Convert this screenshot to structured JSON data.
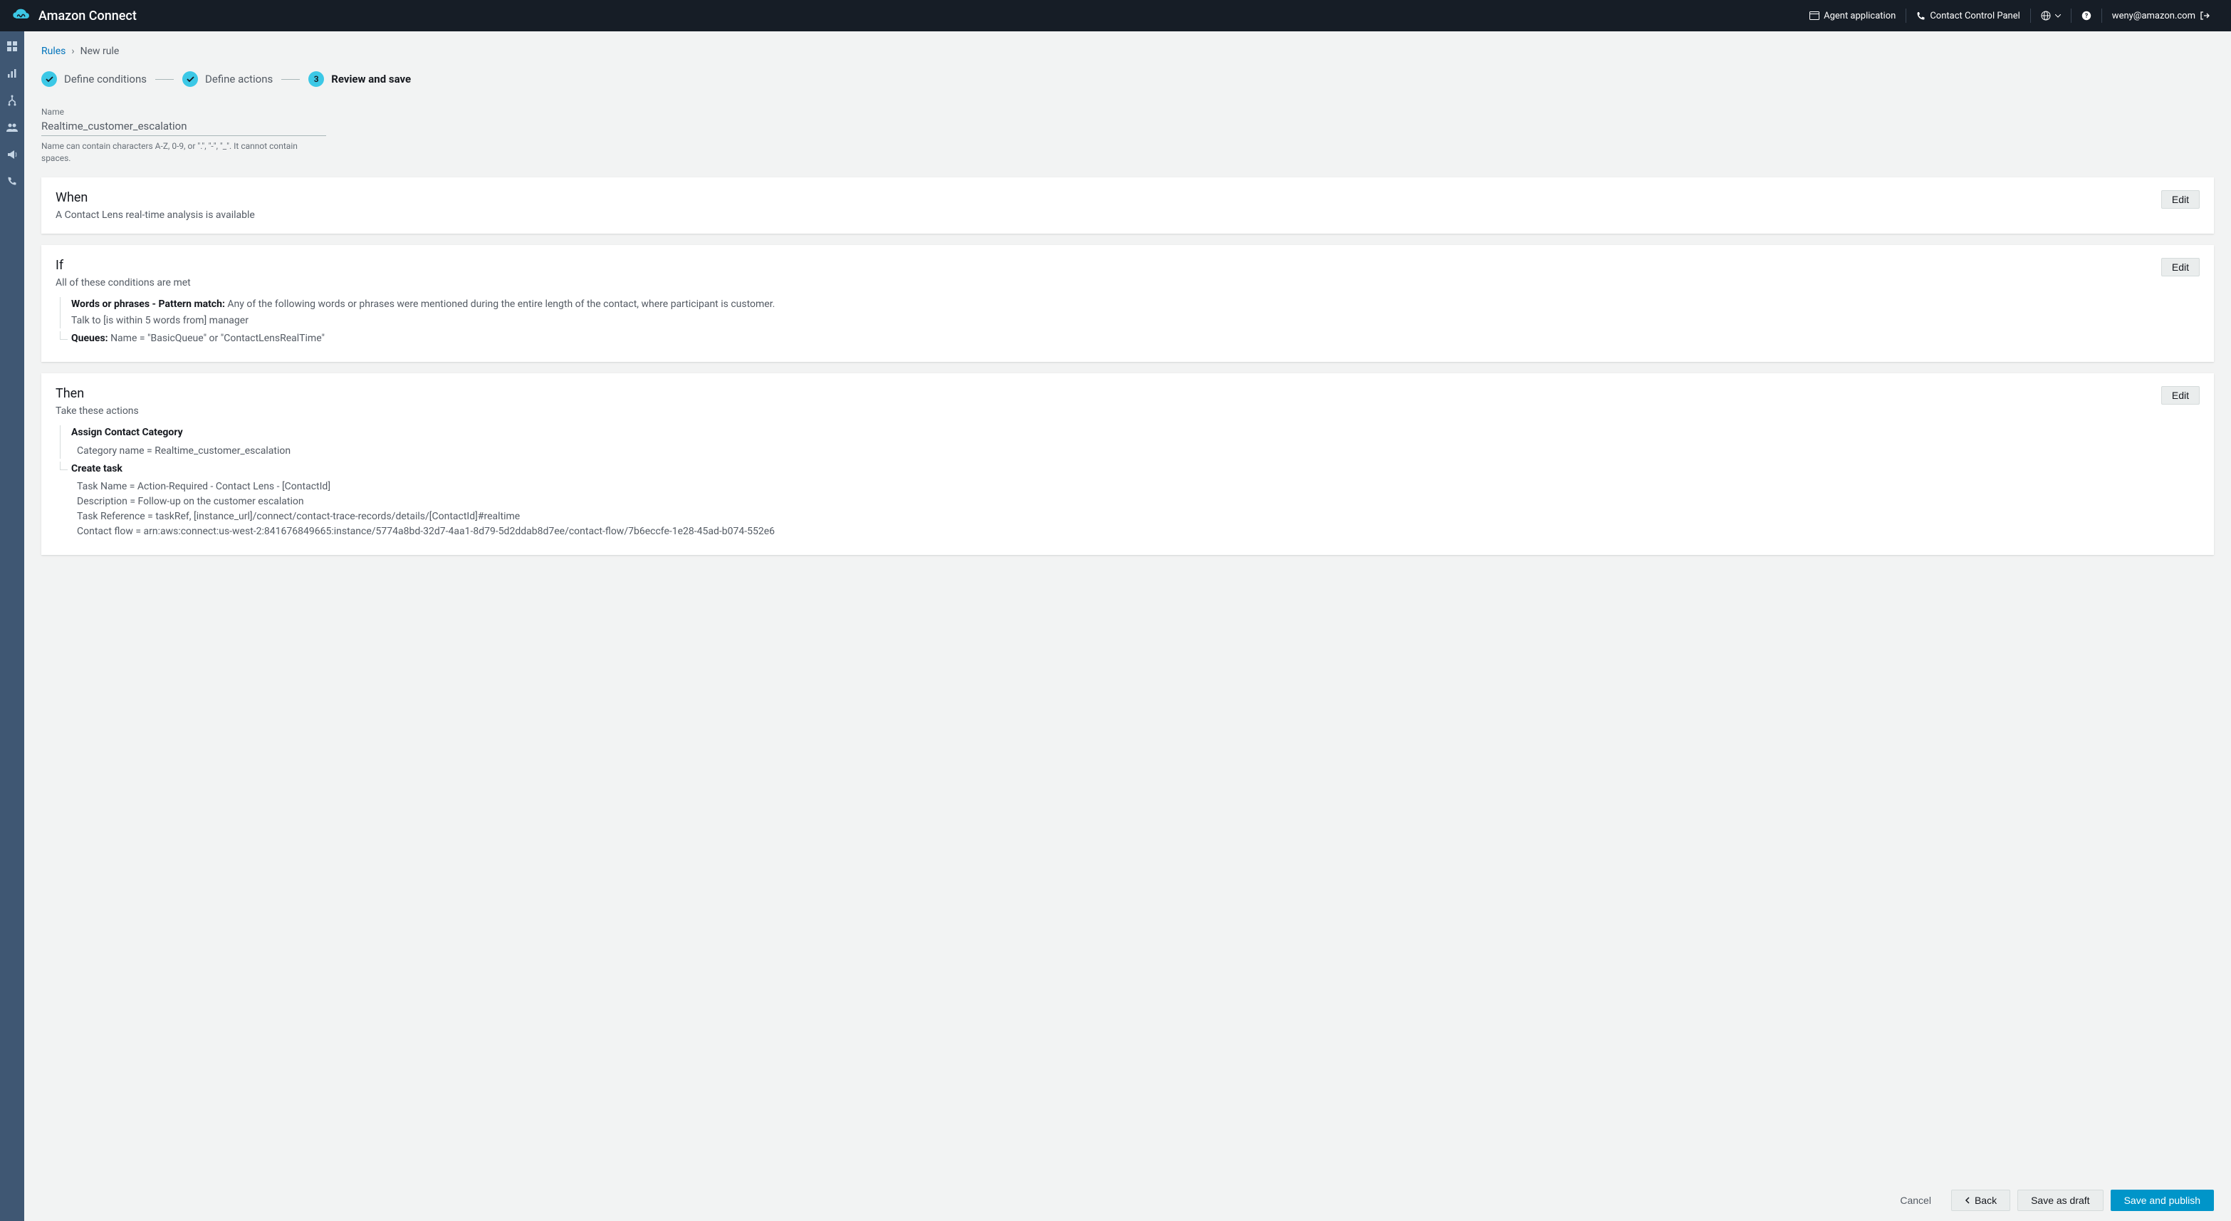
{
  "header": {
    "product_name": "Amazon Connect",
    "agent_app": "Agent application",
    "ccp": "Contact Control Panel",
    "user_email": "weny@amazon.com"
  },
  "breadcrumb": {
    "root": "Rules",
    "current": "New rule"
  },
  "stepper": {
    "step1": "Define conditions",
    "step2": "Define actions",
    "step3_num": "3",
    "step3": "Review and save"
  },
  "name_field": {
    "label": "Name",
    "value": "Realtime_customer_escalation",
    "hint": "Name can contain characters A-Z, 0-9, or \".\", \"-\", \"_\". It cannot contain spaces."
  },
  "when": {
    "title": "When",
    "text": "A Contact Lens real-time analysis is available",
    "edit": "Edit"
  },
  "if": {
    "title": "If",
    "sub": "All of these conditions are met",
    "edit": "Edit",
    "cond1_label": "Words or phrases - Pattern match:",
    "cond1_text": " Any of the following words or phrases were mentioned during the entire length of the contact, where participant is customer.",
    "cond1_detail": "Talk to [is within 5 words from] manager",
    "cond2_label": "Queues:",
    "cond2_text": " Name = \"BasicQueue\" or \"ContactLensRealTime\""
  },
  "then": {
    "title": "Then",
    "sub": "Take these actions",
    "edit": "Edit",
    "action1_title": "Assign Contact Category",
    "action1_line1": "Category name = Realtime_customer_escalation",
    "action2_title": "Create task",
    "action2_line1": "Task Name = Action-Required - Contact Lens - [ContactId]",
    "action2_line2": "Description = Follow-up on the customer escalation",
    "action2_line3": "Task Reference = taskRef, [instance_url]/connect/contact-trace-records/details/[ContactId]#realtime",
    "action2_line4": "Contact flow = arn:aws:connect:us-west-2:841676849665:instance/5774a8bd-32d7-4aa1-8d79-5d2ddab8d7ee/contact-flow/7b6eccfe-1e28-45ad-b074-552e6"
  },
  "footer": {
    "cancel": "Cancel",
    "back": "Back",
    "draft": "Save as draft",
    "publish": "Save and publish"
  }
}
